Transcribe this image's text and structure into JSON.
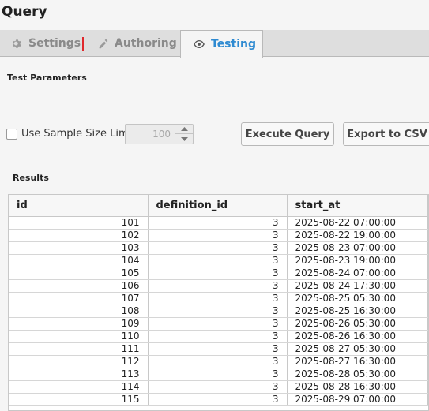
{
  "title": "Query",
  "tabs": {
    "settings": "Settings",
    "authoring": "Authoring",
    "testing": "Testing"
  },
  "active_tab": "Testing",
  "colors": {
    "accent": "#2e8ad1",
    "marker": "#e0282c"
  },
  "test_parameters_label": "Test Parameters",
  "sample_limit": {
    "label": "Use Sample Size Limit",
    "checked": false,
    "value": "100"
  },
  "buttons": {
    "execute": "Execute Query",
    "export": "Export to CSV"
  },
  "results_label": "Results",
  "table": {
    "columns": [
      "id",
      "definition_id",
      "start_at"
    ],
    "rows": [
      [
        "101",
        "3",
        "2025-08-22 07:00:00"
      ],
      [
        "102",
        "3",
        "2025-08-22 19:00:00"
      ],
      [
        "103",
        "3",
        "2025-08-23 07:00:00"
      ],
      [
        "104",
        "3",
        "2025-08-23 19:00:00"
      ],
      [
        "105",
        "3",
        "2025-08-24 07:00:00"
      ],
      [
        "106",
        "3",
        "2025-08-24 17:30:00"
      ],
      [
        "107",
        "3",
        "2025-08-25 05:30:00"
      ],
      [
        "108",
        "3",
        "2025-08-25 16:30:00"
      ],
      [
        "109",
        "3",
        "2025-08-26 05:30:00"
      ],
      [
        "110",
        "3",
        "2025-08-26 16:30:00"
      ],
      [
        "111",
        "3",
        "2025-08-27 05:30:00"
      ],
      [
        "112",
        "3",
        "2025-08-27 16:30:00"
      ],
      [
        "113",
        "3",
        "2025-08-28 05:30:00"
      ],
      [
        "114",
        "3",
        "2025-08-28 16:30:00"
      ],
      [
        "115",
        "3",
        "2025-08-29 07:00:00"
      ]
    ]
  }
}
